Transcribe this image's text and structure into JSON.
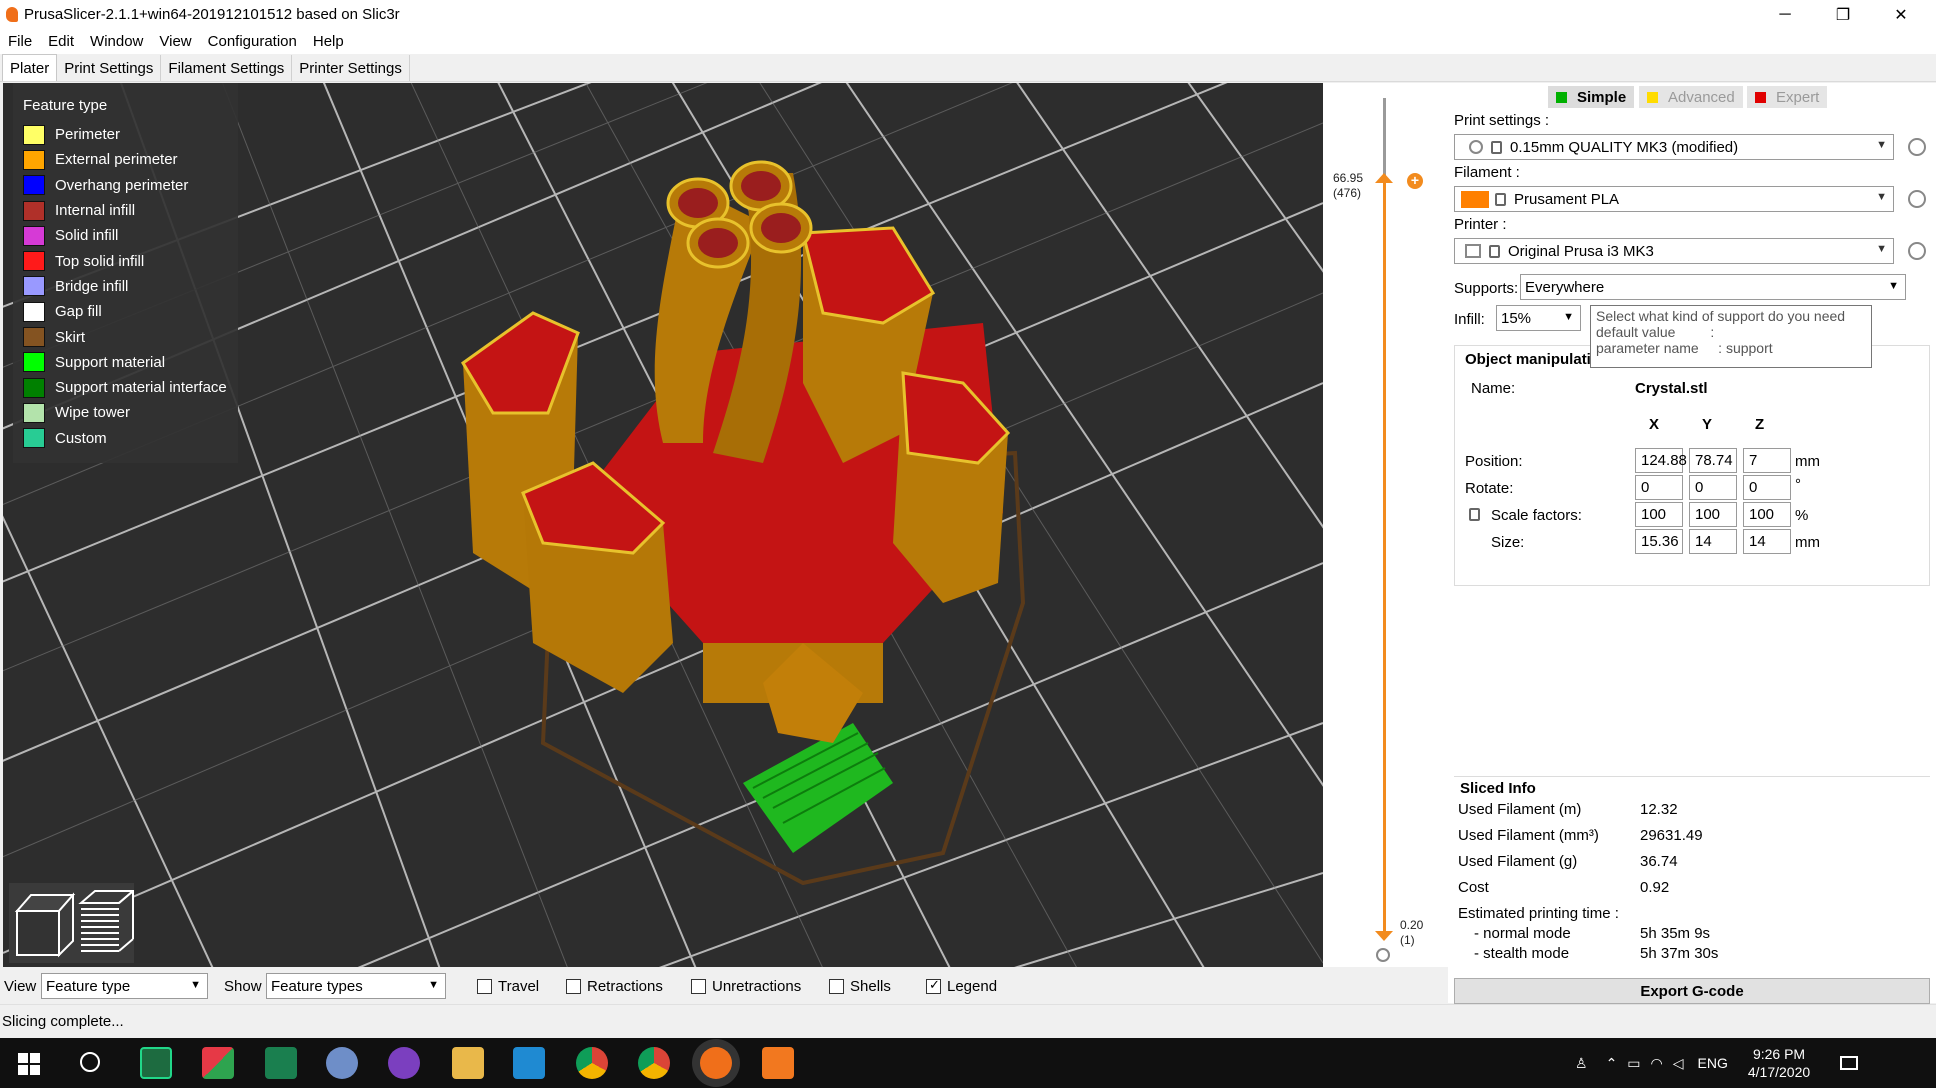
{
  "window": {
    "title": "PrusaSlicer-2.1.1+win64-201912101512 based on Slic3r",
    "min": "─",
    "max": "❐",
    "close": "✕"
  },
  "menu": [
    "File",
    "Edit",
    "Window",
    "View",
    "Configuration",
    "Help"
  ],
  "tabs": [
    "Plater",
    "Print Settings",
    "Filament Settings",
    "Printer Settings"
  ],
  "legend": {
    "title": "Feature type",
    "items": [
      {
        "label": "Perimeter",
        "color": "#ffff66"
      },
      {
        "label": "External perimeter",
        "color": "#ffa500"
      },
      {
        "label": "Overhang perimeter",
        "color": "#0000ff"
      },
      {
        "label": "Internal infill",
        "color": "#b03029"
      },
      {
        "label": "Solid infill",
        "color": "#d63ad6"
      },
      {
        "label": "Top solid infill",
        "color": "#ff1a1a"
      },
      {
        "label": "Bridge infill",
        "color": "#9999ff"
      },
      {
        "label": "Gap fill",
        "color": "#ffffff"
      },
      {
        "label": "Skirt",
        "color": "#845321"
      },
      {
        "label": "Support material",
        "color": "#00ff00"
      },
      {
        "label": "Support material interface",
        "color": "#008000"
      },
      {
        "label": "Wipe tower",
        "color": "#b3e3ab"
      },
      {
        "label": "Custom",
        "color": "#28cc94"
      }
    ]
  },
  "slider": {
    "top_value": "66.95",
    "top_layer": "(476)",
    "bottom_value": "0.20",
    "bottom_layer": "(1)"
  },
  "modes": {
    "simple": "Simple",
    "advanced": "Advanced",
    "expert": "Expert",
    "colors": {
      "simple": "#00b000",
      "advanced": "#ffdc00",
      "expert": "#e00000"
    }
  },
  "print_settings": {
    "label": "Print settings :",
    "value": "0.15mm QUALITY MK3 (modified)"
  },
  "filament": {
    "label": "Filament :",
    "value": "Prusament PLA",
    "color": "#ff8000"
  },
  "printer": {
    "label": "Printer :",
    "value": "Original Prusa i3 MK3"
  },
  "supports": {
    "label": "Supports:",
    "value": "Everywhere"
  },
  "infill": {
    "label": "Infill:",
    "value": "15%"
  },
  "tooltip": {
    "line1": "Select what kind of support do you need",
    "line2": "default value         :",
    "line3": "parameter name     : support"
  },
  "object": {
    "title": "Object manipulati",
    "name_label": "Name:",
    "name": "Crystal.stl",
    "headers": [
      "X",
      "Y",
      "Z"
    ],
    "position": {
      "label": "Position:",
      "values": [
        "124.88",
        "78.74",
        "7"
      ],
      "unit": "mm"
    },
    "rotate": {
      "label": "Rotate:",
      "values": [
        "0",
        "0",
        "0"
      ],
      "unit": "°"
    },
    "scale": {
      "label": "Scale factors:",
      "values": [
        "100",
        "100",
        "100"
      ],
      "unit": "%"
    },
    "size": {
      "label": "Size:",
      "values": [
        "15.36",
        "14",
        "14"
      ],
      "unit": "mm"
    }
  },
  "sliced_info": {
    "title": "Sliced Info",
    "rows": [
      {
        "k": "Used Filament (m)",
        "v": "12.32"
      },
      {
        "k": "Used Filament (mm³)",
        "v": "29631.49"
      },
      {
        "k": "Used Filament (g)",
        "v": "36.74"
      },
      {
        "k": "Cost",
        "v": "0.92"
      },
      {
        "k": "Estimated printing time :",
        "v": ""
      },
      {
        "k": "- normal mode",
        "v": "5h 35m 9s"
      },
      {
        "k": "- stealth mode",
        "v": "5h 37m 30s"
      }
    ]
  },
  "export_label": "Export G-code",
  "bottom": {
    "view_label": "View",
    "view_value": "Feature type",
    "show_label": "Show",
    "show_value": "Feature types",
    "checks": [
      {
        "label": "Travel",
        "checked": false
      },
      {
        "label": "Retractions",
        "checked": false
      },
      {
        "label": "Unretractions",
        "checked": false
      },
      {
        "label": "Shells",
        "checked": false
      },
      {
        "label": "Legend",
        "checked": true
      }
    ]
  },
  "status": "Slicing complete...",
  "tray": {
    "lang": "ENG",
    "time": "9:26 PM",
    "date": "4/17/2020"
  }
}
